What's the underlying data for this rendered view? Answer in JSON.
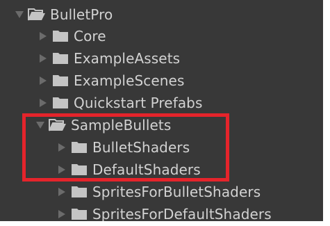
{
  "colors": {
    "panel_background": "#383838",
    "text": "#d2d2d2",
    "arrow": "#6b6b6b",
    "folder_icon": "#c4c4c4",
    "highlight_border": "#e5242b"
  },
  "project_tree": {
    "root": {
      "label": "BulletPro",
      "icon": "folder-open-icon",
      "expanded": true
    },
    "children": [
      {
        "label": "Core",
        "icon": "folder-icon",
        "expanded": false
      },
      {
        "label": "ExampleAssets",
        "icon": "folder-icon",
        "expanded": false
      },
      {
        "label": "ExampleScenes",
        "icon": "folder-icon",
        "expanded": false
      },
      {
        "label": "Quickstart Prefabs",
        "icon": "folder-icon",
        "expanded": false
      },
      {
        "label": "SampleBullets",
        "icon": "folder-open-icon",
        "expanded": true,
        "children": [
          {
            "label": "BulletShaders",
            "icon": "folder-icon",
            "expanded": false
          },
          {
            "label": "DefaultShaders",
            "icon": "folder-icon",
            "expanded": false
          },
          {
            "label": "SpritesForBulletShaders",
            "icon": "folder-icon",
            "expanded": false
          },
          {
            "label": "SpritesForDefaultShaders",
            "icon": "folder-icon",
            "expanded": false
          }
        ]
      }
    ]
  }
}
